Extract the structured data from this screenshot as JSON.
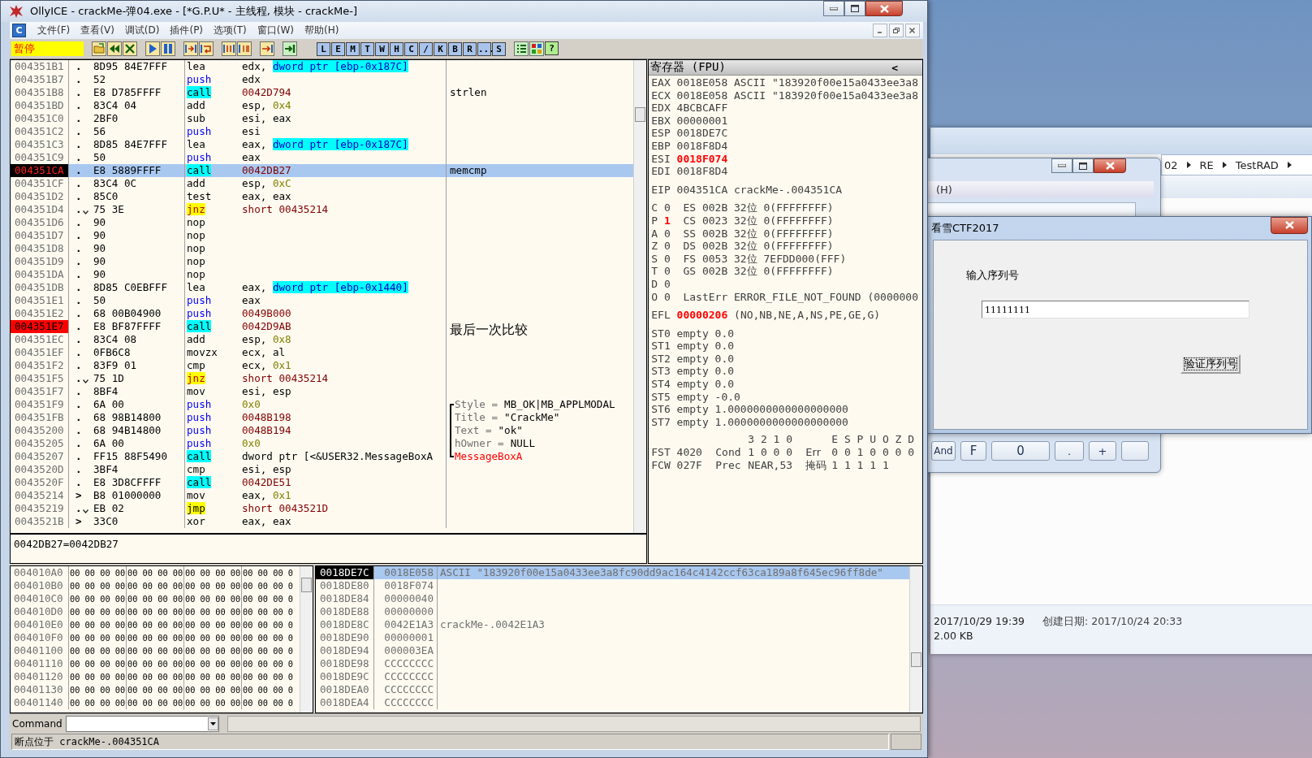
{
  "window": {
    "title": "OllyICE - crackMe-弹04.exe - [*G.P.U* -  主线程, 模块 - crackMe-]"
  },
  "menu": {
    "mdi_icon": "C",
    "items": [
      "文件(F)",
      "查看(V)",
      "调试(D)",
      "插件(P)",
      "选项(T)",
      "窗口(W)",
      "帮助(H)"
    ]
  },
  "toolbar": {
    "status": "暂停",
    "letter_buttons": [
      "L",
      "E",
      "M",
      "T",
      "W",
      "H",
      "C",
      "/",
      "K",
      "B",
      "R",
      "...",
      "S"
    ],
    "help_button": "?"
  },
  "disassembly": {
    "rows": [
      {
        "address": "004351B1",
        "marker": ".",
        "hex": "8D95 84E7FFF",
        "mnemonic": "lea",
        "kind": "plain",
        "operands": [
          {
            "text": "edx, ",
            "kind": "plain"
          },
          {
            "text": "dword ptr [ebp-0x187C]",
            "kind": "memory"
          }
        ]
      },
      {
        "address": "004351B7",
        "marker": ".",
        "hex": "52",
        "mnemonic": "push",
        "kind": "push",
        "operands": [
          {
            "text": "edx",
            "kind": "plain"
          }
        ]
      },
      {
        "address": "004351B8",
        "marker": ".",
        "hex": "E8 D785FFFF",
        "mnemonic": "call",
        "kind": "call",
        "operands": [
          {
            "text": "0042D794",
            "kind": "address"
          }
        ],
        "comment": {
          "kind": "plain",
          "text": "strlen"
        }
      },
      {
        "address": "004351BD",
        "marker": ".",
        "hex": "83C4 04",
        "mnemonic": "add",
        "kind": "plain",
        "operands": [
          {
            "text": "esp, ",
            "kind": "plain"
          },
          {
            "text": "0x4",
            "kind": "constant"
          }
        ]
      },
      {
        "address": "004351C0",
        "marker": ".",
        "hex": "2BF0",
        "mnemonic": "sub",
        "kind": "plain",
        "operands": [
          {
            "text": "esi, eax",
            "kind": "plain"
          }
        ]
      },
      {
        "address": "004351C2",
        "marker": ".",
        "hex": "56",
        "mnemonic": "push",
        "kind": "push",
        "operands": [
          {
            "text": "esi",
            "kind": "plain"
          }
        ]
      },
      {
        "address": "004351C3",
        "marker": ".",
        "hex": "8D85 84E7FFF",
        "mnemonic": "lea",
        "kind": "plain",
        "operands": [
          {
            "text": "eax, ",
            "kind": "plain"
          },
          {
            "text": "dword ptr [ebp-0x187C]",
            "kind": "memory"
          }
        ]
      },
      {
        "address": "004351C9",
        "marker": ".",
        "hex": "50",
        "mnemonic": "push",
        "kind": "push",
        "operands": [
          {
            "text": "eax",
            "kind": "plain"
          }
        ]
      },
      {
        "address": "004351CA",
        "marker": ".",
        "hex": "E8 5889FFFF",
        "mnemonic": "call",
        "kind": "call",
        "operands": [
          {
            "text": "0042DB27",
            "kind": "address"
          }
        ],
        "comment": {
          "kind": "plain",
          "text": "memcmp"
        },
        "selected": true,
        "eip": true,
        "breakpoint": true
      },
      {
        "address": "004351CF",
        "marker": ".",
        "hex": "83C4 0C",
        "mnemonic": "add",
        "kind": "plain",
        "operands": [
          {
            "text": "esp, ",
            "kind": "plain"
          },
          {
            "text": "0xC",
            "kind": "constant"
          }
        ]
      },
      {
        "address": "004351D2",
        "marker": ".",
        "hex": "85C0",
        "mnemonic": "test",
        "kind": "plain",
        "operands": [
          {
            "text": "eax, eax",
            "kind": "plain"
          }
        ]
      },
      {
        "address": "004351D4",
        "marker": ".",
        "branch": true,
        "hex": "75 3E",
        "mnemonic": "jnz",
        "kind": "cjump",
        "operands": [
          {
            "text": "short ",
            "kind": "address"
          },
          {
            "text": "00435214",
            "kind": "address"
          }
        ]
      },
      {
        "address": "004351D6",
        "marker": ".",
        "hex": "90",
        "mnemonic": "nop",
        "kind": "plain",
        "operands": []
      },
      {
        "address": "004351D7",
        "marker": ".",
        "hex": "90",
        "mnemonic": "nop",
        "kind": "plain",
        "operands": []
      },
      {
        "address": "004351D8",
        "marker": ".",
        "hex": "90",
        "mnemonic": "nop",
        "kind": "plain",
        "operands": []
      },
      {
        "address": "004351D9",
        "marker": ".",
        "hex": "90",
        "mnemonic": "nop",
        "kind": "plain",
        "operands": []
      },
      {
        "address": "004351DA",
        "marker": ".",
        "hex": "90",
        "mnemonic": "nop",
        "kind": "plain",
        "operands": []
      },
      {
        "address": "004351DB",
        "marker": ".",
        "hex": "8D85 C0EBFFF",
        "mnemonic": "lea",
        "kind": "plain",
        "operands": [
          {
            "text": "eax, ",
            "kind": "plain"
          },
          {
            "text": "dword ptr [ebp-0x1440]",
            "kind": "memory"
          }
        ]
      },
      {
        "address": "004351E1",
        "marker": ".",
        "hex": "50",
        "mnemonic": "push",
        "kind": "push",
        "operands": [
          {
            "text": "eax",
            "kind": "plain"
          }
        ]
      },
      {
        "address": "004351E2",
        "marker": ".",
        "hex": "68 00B04900",
        "mnemonic": "push",
        "kind": "push",
        "operands": [
          {
            "text": "0049B000",
            "kind": "address"
          }
        ]
      },
      {
        "address": "004351E7",
        "marker": ".",
        "hex": "E8 BF87FFFF",
        "mnemonic": "call",
        "kind": "call",
        "operands": [
          {
            "text": "0042D9AB",
            "kind": "address"
          }
        ],
        "comment": {
          "kind": "note",
          "text": "最后一次比较"
        },
        "breakpoint": true
      },
      {
        "address": "004351EC",
        "marker": ".",
        "hex": "83C4 08",
        "mnemonic": "add",
        "kind": "plain",
        "operands": [
          {
            "text": "esp, ",
            "kind": "plain"
          },
          {
            "text": "0x8",
            "kind": "constant"
          }
        ]
      },
      {
        "address": "004351EF",
        "marker": ".",
        "hex": "0FB6C8",
        "mnemonic": "movzx",
        "kind": "plain",
        "operands": [
          {
            "text": "ecx, al",
            "kind": "plain"
          }
        ]
      },
      {
        "address": "004351F2",
        "marker": ".",
        "hex": "83F9 01",
        "mnemonic": "cmp",
        "kind": "plain",
        "operands": [
          {
            "text": "ecx, ",
            "kind": "plain"
          },
          {
            "text": "0x1",
            "kind": "constant"
          }
        ]
      },
      {
        "address": "004351F5",
        "marker": ".",
        "branch": true,
        "hex": "75 1D",
        "mnemonic": "jnz",
        "kind": "cjump",
        "operands": [
          {
            "text": "short ",
            "kind": "address"
          },
          {
            "text": "00435214",
            "kind": "address"
          }
        ]
      },
      {
        "address": "004351F7",
        "marker": ".",
        "hex": "8BF4",
        "mnemonic": "mov",
        "kind": "plain",
        "operands": [
          {
            "text": "esi, esp",
            "kind": "plain"
          }
        ]
      },
      {
        "address": "004351F9",
        "marker": ".",
        "hex": "6A 00",
        "mnemonic": "push",
        "kind": "push",
        "operands": [
          {
            "text": "0x0",
            "kind": "constant"
          }
        ],
        "comment": {
          "kind": "arg",
          "bracket": true,
          "bracket_start": true,
          "label": "Style =",
          "text": "MB_OK|MB_APPLMODAL"
        }
      },
      {
        "address": "004351FB",
        "marker": ".",
        "hex": "68 98B14800",
        "mnemonic": "push",
        "kind": "push",
        "operands": [
          {
            "text": "0048B198",
            "kind": "address"
          }
        ],
        "comment": {
          "kind": "arg",
          "bracket": true,
          "label": "Title =",
          "text": "\"CrackMe\""
        }
      },
      {
        "address": "00435200",
        "marker": ".",
        "hex": "68 94B14800",
        "mnemonic": "push",
        "kind": "push",
        "operands": [
          {
            "text": "0048B194",
            "kind": "address"
          }
        ],
        "comment": {
          "kind": "arg",
          "bracket": true,
          "label": "Text =",
          "text": "\"ok\""
        }
      },
      {
        "address": "00435205",
        "marker": ".",
        "hex": "6A 00",
        "mnemonic": "push",
        "kind": "push",
        "operands": [
          {
            "text": "0x0",
            "kind": "constant"
          }
        ],
        "comment": {
          "kind": "arg",
          "bracket": true,
          "label": "hOwner =",
          "text": "NULL"
        }
      },
      {
        "address": "00435207",
        "marker": ".",
        "hex": "FF15 88F5490",
        "mnemonic": "call",
        "kind": "call",
        "operands": [
          {
            "text": "dword ptr [<&USER32.MessageBoxA",
            "kind": "plain"
          }
        ],
        "comment": {
          "kind": "api",
          "bracket": true,
          "bracket_end": true,
          "text": "MessageBoxA"
        }
      },
      {
        "address": "0043520D",
        "marker": ".",
        "hex": "3BF4",
        "mnemonic": "cmp",
        "kind": "plain",
        "operands": [
          {
            "text": "esi, esp",
            "kind": "plain"
          }
        ]
      },
      {
        "address": "0043520F",
        "marker": ".",
        "hex": "E8 3D8CFFFF",
        "mnemonic": "call",
        "kind": "call",
        "operands": [
          {
            "text": "0042DE51",
            "kind": "address"
          }
        ]
      },
      {
        "address": "00435214",
        "marker": ">",
        "hex": "B8 01000000",
        "mnemonic": "mov",
        "kind": "plain",
        "operands": [
          {
            "text": "eax, ",
            "kind": "plain"
          },
          {
            "text": "0x1",
            "kind": "constant"
          }
        ]
      },
      {
        "address": "00435219",
        "marker": ".",
        "branch": true,
        "hex": "EB 02",
        "mnemonic": "jmp",
        "kind": "jump",
        "operands": [
          {
            "text": "short ",
            "kind": "address"
          },
          {
            "text": "0043521D",
            "kind": "address"
          }
        ]
      },
      {
        "address": "0043521B",
        "marker": ">",
        "hex": "33C0",
        "mnemonic": "xor",
        "kind": "plain",
        "operands": [
          {
            "text": "eax, eax",
            "kind": "plain"
          }
        ]
      }
    ],
    "info": "0042DB27=0042DB27"
  },
  "registers": {
    "title": "寄存器 (FPU)",
    "collapse": "<",
    "groups": [
      [
        [
          {
            "text": "EAX 0018E058 ASCII \"183920f00e15a0433ee3a8",
            "kind": "normal"
          }
        ],
        [
          {
            "text": "ECX 0018E058 ASCII \"183920f00e15a0433ee3a8",
            "kind": "normal"
          }
        ],
        [
          {
            "text": "EDX 4BCBCAFF",
            "kind": "normal"
          }
        ],
        [
          {
            "text": "EBX 00000001",
            "kind": "normal"
          }
        ],
        [
          {
            "text": "ESP 0018DE7C",
            "kind": "normal"
          }
        ],
        [
          {
            "text": "EBP 0018F8D4",
            "kind": "normal"
          }
        ],
        [
          {
            "text": "ESI ",
            "kind": "normal"
          },
          {
            "text": "0018F074",
            "kind": "changed"
          }
        ],
        [
          {
            "text": "EDI 0018F8D4",
            "kind": "normal"
          }
        ]
      ],
      [
        [
          {
            "text": "EIP 004351CA crackMe-.004351CA",
            "kind": "normal"
          }
        ]
      ],
      [
        [
          {
            "text": "C 0  ES 002B 32位 0(FFFFFFFF)",
            "kind": "normal"
          }
        ],
        [
          {
            "text": "P ",
            "kind": "normal"
          },
          {
            "text": "1",
            "kind": "changed"
          },
          {
            "text": "  CS 0023 32位 0(FFFFFFFF)",
            "kind": "normal"
          }
        ],
        [
          {
            "text": "A 0  SS 002B 32位 0(FFFFFFFF)",
            "kind": "normal"
          }
        ],
        [
          {
            "text": "Z 0  DS 002B 32位 0(FFFFFFFF)",
            "kind": "normal"
          }
        ],
        [
          {
            "text": "S 0  FS 0053 32位 7EFDD000(FFF)",
            "kind": "normal"
          }
        ],
        [
          {
            "text": "T 0  GS 002B 32位 0(FFFFFFFF)",
            "kind": "normal"
          }
        ],
        [
          {
            "text": "D 0",
            "kind": "normal"
          }
        ],
        [
          {
            "text": "O 0  LastErr ERROR_FILE_NOT_FOUND (0000000",
            "kind": "normal"
          }
        ]
      ],
      [
        [
          {
            "text": "EFL ",
            "kind": "normal"
          },
          {
            "text": "00000206",
            "kind": "changed"
          },
          {
            "text": " (NO,NB,NE,A,NS,PE,GE,G)",
            "kind": "normal"
          }
        ]
      ],
      [
        [
          {
            "text": "ST0 empty 0.0",
            "kind": "normal"
          }
        ],
        [
          {
            "text": "ST1 empty 0.0",
            "kind": "normal"
          }
        ],
        [
          {
            "text": "ST2 empty 0.0",
            "kind": "normal"
          }
        ],
        [
          {
            "text": "ST3 empty 0.0",
            "kind": "normal"
          }
        ],
        [
          {
            "text": "ST4 empty 0.0",
            "kind": "normal"
          }
        ],
        [
          {
            "text": "ST5 empty -0.0",
            "kind": "normal"
          }
        ],
        [
          {
            "text": "ST6 empty 1.0000000000000000000",
            "kind": "normal"
          }
        ],
        [
          {
            "text": "ST7 empty 1.0000000000000000000",
            "kind": "normal"
          }
        ]
      ]
    ],
    "fpu": {
      "header": {
        "cond_bits": "3 2 1 0",
        "err_bits": "E S P U O Z D"
      },
      "rows": [
        {
          "reg": "FST 4020",
          "name": "Cond",
          "bits": "1 0 0 0",
          "name2": "Err",
          "bits2": "0 0 1 0 0 0 0"
        },
        {
          "reg": "FCW 027F",
          "name": "Prec",
          "bits": "NEAR,53",
          "name2": "掩码",
          "bits2": "1 1 1 1 1"
        }
      ]
    }
  },
  "dump": {
    "rows": [
      {
        "address": "004010A0",
        "groups": [
          "00 00 00 00",
          "00 00 00 00",
          "00 00 00 00",
          "00 00 00 0"
        ]
      },
      {
        "address": "004010B0",
        "groups": [
          "00 00 00 00",
          "00 00 00 00",
          "00 00 00 00",
          "00 00 00 0"
        ]
      },
      {
        "address": "004010C0",
        "groups": [
          "00 00 00 00",
          "00 00 00 00",
          "00 00 00 00",
          "00 00 00 0"
        ]
      },
      {
        "address": "004010D0",
        "groups": [
          "00 00 00 00",
          "00 00 00 00",
          "00 00 00 00",
          "00 00 00 0"
        ]
      },
      {
        "address": "004010E0",
        "groups": [
          "00 00 00 00",
          "00 00 00 00",
          "00 00 00 00",
          "00 00 00 0"
        ]
      },
      {
        "address": "004010F0",
        "groups": [
          "00 00 00 00",
          "00 00 00 00",
          "00 00 00 00",
          "00 00 00 0"
        ]
      },
      {
        "address": "00401100",
        "groups": [
          "00 00 00 00",
          "00 00 00 00",
          "00 00 00 00",
          "00 00 00 0"
        ]
      },
      {
        "address": "00401110",
        "groups": [
          "00 00 00 00",
          "00 00 00 00",
          "00 00 00 00",
          "00 00 00 0"
        ]
      },
      {
        "address": "00401120",
        "groups": [
          "00 00 00 00",
          "00 00 00 00",
          "00 00 00 00",
          "00 00 00 0"
        ]
      },
      {
        "address": "00401130",
        "groups": [
          "00 00 00 00",
          "00 00 00 00",
          "00 00 00 00",
          "00 00 00 0"
        ]
      },
      {
        "address": "00401140",
        "groups": [
          "00 00 00 00",
          "00 00 00 00",
          "00 00 00 00",
          "00 00 00 0"
        ]
      }
    ]
  },
  "stack": {
    "rows": [
      {
        "address": "0018DE7C",
        "value": "0018E058",
        "comment": "ASCII \"183920f00e15a0433ee3a8fc90dd9ac164c4142ccf63ca189a8f645ec96ff8de\"",
        "selected": true,
        "esp": true
      },
      {
        "address": "0018DE80",
        "value": "0018F074",
        "selected": false,
        "esp": false
      },
      {
        "address": "0018DE84",
        "value": "00000040",
        "selected": false,
        "esp": false
      },
      {
        "address": "0018DE88",
        "value": "00000000",
        "selected": false,
        "esp": false
      },
      {
        "address": "0018DE8C",
        "value": "0042E1A3",
        "comment": "crackMe-.0042E1A3",
        "selected": false,
        "esp": false
      },
      {
        "address": "0018DE90",
        "value": "00000001",
        "selected": false,
        "esp": false
      },
      {
        "address": "0018DE94",
        "value": "000003EA",
        "selected": false,
        "esp": false
      },
      {
        "address": "0018DE98",
        "value": "CCCCCCCC",
        "selected": false,
        "esp": false
      },
      {
        "address": "0018DE9C",
        "value": "CCCCCCCC",
        "selected": false,
        "esp": false
      },
      {
        "address": "0018DEA0",
        "value": "CCCCCCCC",
        "selected": false,
        "esp": false
      },
      {
        "address": "0018DEA4",
        "value": "CCCCCCCC",
        "selected": false,
        "esp": false
      }
    ]
  },
  "command": {
    "label": "Command"
  },
  "status_bar": {
    "text": "断点位于 crackMe-.004351CA"
  },
  "explorer": {
    "breadcrumb": [
      "02",
      "RE",
      "TestRAD"
    ],
    "modified": "2017/10/29 19:39",
    "created": "创建日期: 2017/10/24 20:33",
    "size": "2.00 KB"
  },
  "calculator": {
    "menu_fragment": "(H)",
    "buttons": [
      "And",
      "F",
      "0",
      ".",
      "+"
    ]
  },
  "dialog": {
    "title": "看雪CTF2017",
    "label": "输入序列号",
    "serial": "11111111",
    "button": "验证序列号"
  }
}
